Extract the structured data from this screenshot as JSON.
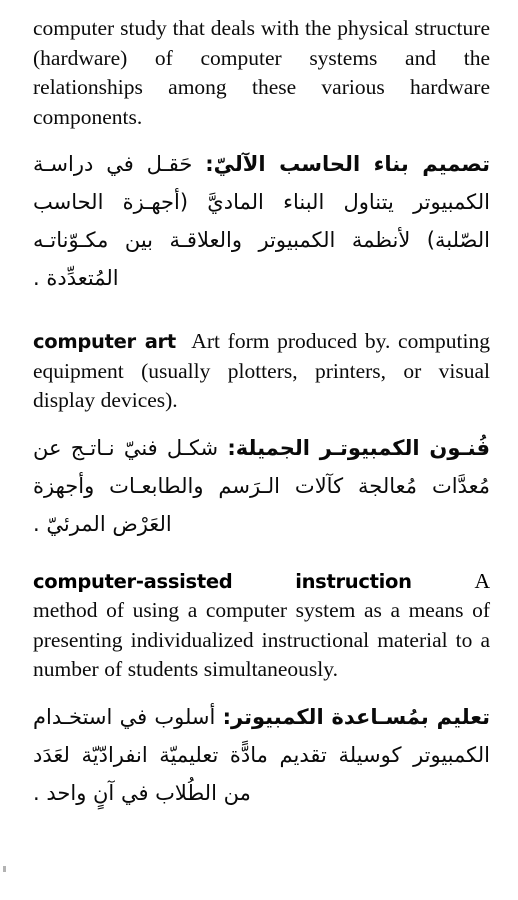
{
  "page": {
    "language_primary": "English",
    "language_secondary": "Arabic",
    "background_color": "#ffffff",
    "text_color": "#000000"
  },
  "entries": [
    {
      "id": "computer-architecture-continuation",
      "english": {
        "headword": "",
        "definition": "computer study that deals with the physical structure (hardware) of computer systems and the relationships among these various hardware components."
      },
      "arabic": {
        "headword": "تصميم بناء الحاسب الآليّ:",
        "definition": "حَقـل في دراسـة الكمبيوتر يتناول البناء الماديَّ (أجهـزة الحاسب الصّلبة) لأنظمة الكمبيوتر والعلاقـة بين مكـوّناتـه المُتعدِّدة ."
      }
    },
    {
      "id": "computer-art",
      "english": {
        "headword": "computer art",
        "definition": "Art form produced by. computing equipment (usually plotters, printers, or visual display devices)."
      },
      "arabic": {
        "headword": "فُنـون الكمبيوتـر الجميلة:",
        "definition": "شكـل فنيّ نـاتـج عن مُعدَّات مُعالجة كآلات الـرَسم والطابعـات وأجهزة العَرْض المرئيّ ."
      }
    },
    {
      "id": "computer-assisted-instruction",
      "english": {
        "headword_left": "computer-assisted",
        "headword_right": "instruction",
        "headword_tail": "A",
        "definition": "method of using a computer system as a means of presenting individualized instructional material to a number of students simultaneously."
      },
      "arabic": {
        "headword": "تعليم بمُسـاعدة الكمبيوتر:",
        "definition": "أسلوب في استخـدام الكمبيوتر كوسيلة تقديم مادًّة تعليميّة انفرادّيّة لعَدَد من الطُلاب في آنٍ واحد ."
      }
    }
  ]
}
